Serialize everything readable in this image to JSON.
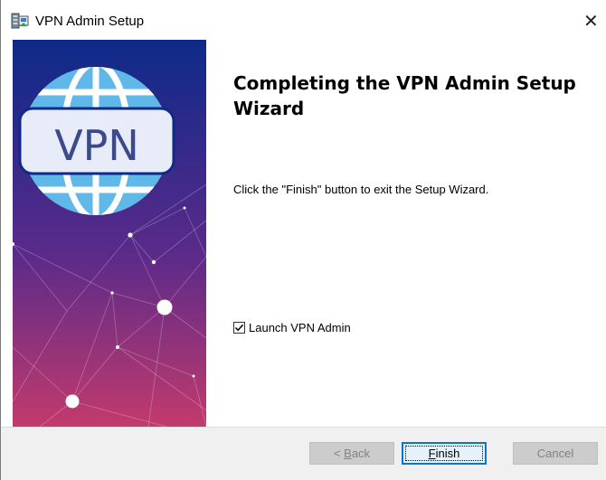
{
  "window": {
    "title": "VPN Admin Setup",
    "close_glyph": "✕"
  },
  "sidebar": {
    "logo_text": "VPN",
    "gradient_top": "#0d2a88",
    "gradient_bottom": "#c23a6c",
    "globe_color": "#5fb8e8",
    "badge_color": "#e8ecf9"
  },
  "wizard": {
    "heading": "Completing the VPN Admin Setup Wizard",
    "description": "Click the \"Finish\" button to exit the Setup Wizard.",
    "launch_checkbox": {
      "label": "Launch VPN Admin",
      "checked": true
    }
  },
  "buttons": {
    "back": {
      "prefix": "< ",
      "mnemonic": "B",
      "rest": "ack",
      "enabled": false
    },
    "finish": {
      "mnemonic": "F",
      "rest": "inish",
      "enabled": true
    },
    "cancel": {
      "label": "Cancel",
      "enabled": false
    }
  },
  "colors": {
    "accent": "#0078d7",
    "footer_bg": "#f0f0f0"
  }
}
